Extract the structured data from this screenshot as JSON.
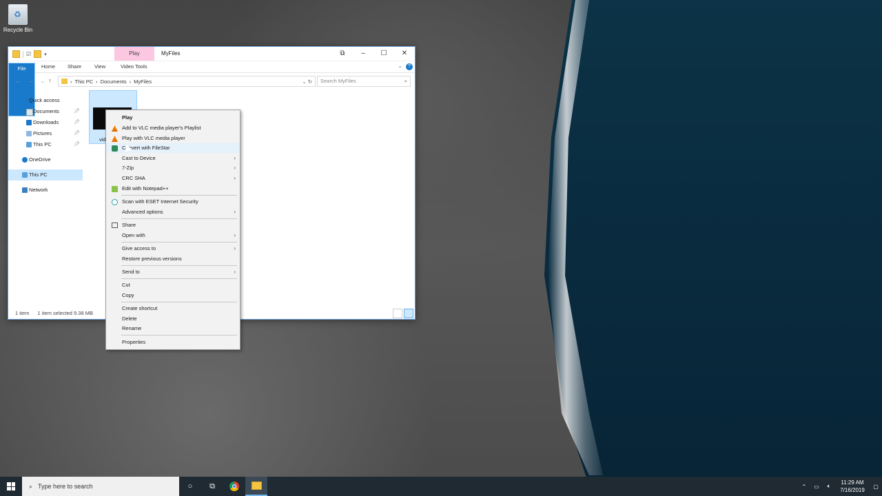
{
  "desktop": {
    "recycle_bin": "Recycle Bin"
  },
  "window": {
    "title": "MyFiles",
    "context_tab": "Play",
    "tabs": [
      "File",
      "Home",
      "Share",
      "View",
      "Video Tools"
    ],
    "breadcrumb": [
      "This PC",
      "Documents",
      "MyFiles"
    ],
    "search_placeholder": "Search MyFiles",
    "nav": {
      "quick_access": "Quick access",
      "documents": "Documents",
      "downloads": "Downloads",
      "pictures": "Pictures",
      "this_pc_pinned": "This PC",
      "onedrive": "OneDrive",
      "this_pc": "This PC",
      "network": "Network"
    },
    "file_name_visible": "vid",
    "status": {
      "count": "1 item",
      "selection": "1 item selected  9.38 MB"
    }
  },
  "context_menu": {
    "play": "Play",
    "vlc_playlist": "Add to VLC media player's Playlist",
    "vlc_play": "Play with VLC media player",
    "filestar": "Convert with FileStar",
    "cast": "Cast to Device",
    "zip": "7-Zip",
    "crc": "CRC SHA",
    "notepad": "Edit with Notepad++",
    "eset": "Scan with ESET Internet Security",
    "advanced": "Advanced options",
    "share": "Share",
    "open_with": "Open with",
    "give_access": "Give access to",
    "restore": "Restore previous versions",
    "send_to": "Send to",
    "cut": "Cut",
    "copy": "Copy",
    "create_shortcut": "Create shortcut",
    "delete": "Delete",
    "rename": "Rename",
    "properties": "Properties"
  },
  "taskbar": {
    "search_placeholder": "Type here to search",
    "time": "11:29 AM",
    "date": "7/16/2019"
  },
  "colors": {
    "accent": "#1979ca",
    "selection": "#cce8ff",
    "play_tab": "#fcc8e1",
    "taskbar": "#1f2a33"
  }
}
